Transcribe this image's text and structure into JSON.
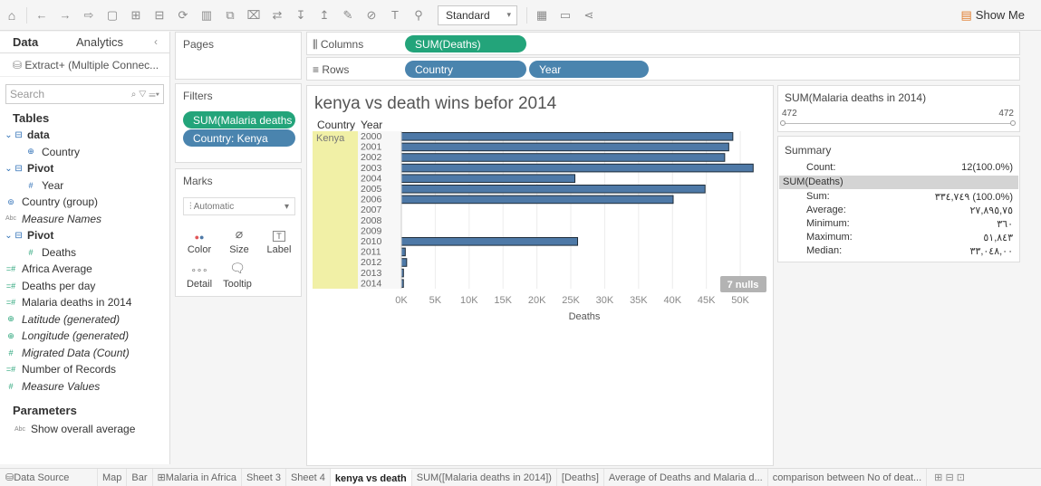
{
  "toolbar": {
    "fit": "Standard",
    "show_me": "Show Me",
    "icons": [
      "home-icon",
      "undo-icon",
      "redo-icon",
      "repeat-icon",
      "save-icon",
      "new-datasource-icon",
      "new-sheet-icon",
      "refresh-icon",
      "pause-icon",
      "swap-icon",
      "sort-asc-icon",
      "sort-desc-icon",
      "highlight-icon",
      "group-icon",
      "label-icon",
      "fix-axes-icon",
      "fit-icon",
      "presentation-icon",
      "share-icon"
    ]
  },
  "datapane": {
    "tab_data": "Data",
    "tab_analytics": "Analytics",
    "collapse": "‹",
    "datasource": "Extract+ (Multiple Connec...",
    "search_placeholder": "Search",
    "tables_heading": "Tables",
    "fields": [
      {
        "label": "data",
        "kind": "table",
        "bold": true
      },
      {
        "label": "Country",
        "kind": "geo",
        "indent": 2
      },
      {
        "label": "Pivot",
        "kind": "table",
        "bold": true
      },
      {
        "label": "Year",
        "kind": "dim",
        "indent": 2
      },
      {
        "label": "Country (group)",
        "kind": "group",
        "indent": 1
      },
      {
        "label": "Measure Names",
        "kind": "abc",
        "indent": 1,
        "italic": true
      },
      {
        "label": "Pivot",
        "kind": "table",
        "bold": true
      },
      {
        "label": "Deaths",
        "kind": "measure",
        "indent": 2
      },
      {
        "label": "Africa Average",
        "kind": "calc",
        "indent": 1
      },
      {
        "label": "Deaths per day",
        "kind": "calc",
        "indent": 1
      },
      {
        "label": "Malaria deaths in 2014",
        "kind": "calc",
        "indent": 1
      },
      {
        "label": "Latitude (generated)",
        "kind": "geo-measure",
        "indent": 1,
        "italic": true
      },
      {
        "label": "Longitude (generated)",
        "kind": "geo-measure",
        "indent": 1,
        "italic": true
      },
      {
        "label": "Migrated Data (Count)",
        "kind": "measure",
        "indent": 1,
        "italic": true
      },
      {
        "label": "Number of Records",
        "kind": "calc",
        "indent": 1
      },
      {
        "label": "Measure Values",
        "kind": "measure",
        "indent": 1,
        "italic": true
      }
    ],
    "params_heading": "Parameters",
    "params": [
      {
        "label": "Show overall average"
      }
    ]
  },
  "pages": {
    "title": "Pages"
  },
  "filters": {
    "title": "Filters",
    "pills": [
      "SUM(Malaria deaths ..",
      "Country: Kenya"
    ]
  },
  "marks": {
    "title": "Marks",
    "type": "Automatic",
    "buttons": [
      "Color",
      "Size",
      "Label",
      "Detail",
      "Tooltip"
    ]
  },
  "shelves": {
    "columns_label": "Columns",
    "rows_label": "Rows",
    "columns": [
      "SUM(Deaths)"
    ],
    "rows": [
      "Country",
      "Year"
    ]
  },
  "view": {
    "title": "kenya vs death wins befor 2014",
    "header_country": "Country",
    "header_year": "Year",
    "nulls_badge": "7 nulls"
  },
  "chart_data": {
    "type": "bar",
    "orientation": "horizontal",
    "title": "kenya vs death wins befor 2014",
    "country": "Kenya",
    "categories": [
      "2000",
      "2001",
      "2002",
      "2003",
      "2004",
      "2005",
      "2006",
      "2007",
      "2008",
      "2009",
      "2010",
      "2011",
      "2012",
      "2013",
      "2014"
    ],
    "values": [
      48900,
      48300,
      47700,
      51900,
      25600,
      44800,
      40100,
      null,
      null,
      null,
      26000,
      580,
      780,
      310,
      300
    ],
    "xlabel": "Deaths",
    "xticks": [
      "0K",
      "5K",
      "10K",
      "15K",
      "20K",
      "25K",
      "30K",
      "35K",
      "40K",
      "45K",
      "50K"
    ],
    "xlim": [
      0,
      54000
    ],
    "grid": true,
    "bar_color": "#4e79a7"
  },
  "filter_card": {
    "title": "SUM(Malaria deaths in 2014)",
    "min": "472",
    "max": "472"
  },
  "summary": {
    "title": "Summary",
    "count_label": "Count:",
    "count_value": "12(100.0%)",
    "measure": "SUM(Deaths)",
    "rows": [
      {
        "k": "Sum:",
        "v": "٣٣٤,٧٤٩ (100.0%)"
      },
      {
        "k": "Average:",
        "v": "٢٧,٨٩٥,٧٥"
      },
      {
        "k": "Minimum:",
        "v": "٣٦٠"
      },
      {
        "k": "Maximum:",
        "v": "٥١,٨٤٣"
      },
      {
        "k": "Median:",
        "v": "٣٣,٠٤٨,٠٠"
      }
    ]
  },
  "sheet_tabs": [
    "Data Source",
    "Map",
    "Bar",
    "Malaria in Africa",
    "Sheet 3",
    "Sheet 4",
    "kenya vs death",
    "SUM([Malaria deaths in 2014])",
    "[Deaths]",
    "Average of Deaths and Malaria d...",
    "comparison between No of deat..."
  ],
  "active_tab": "kenya vs death"
}
